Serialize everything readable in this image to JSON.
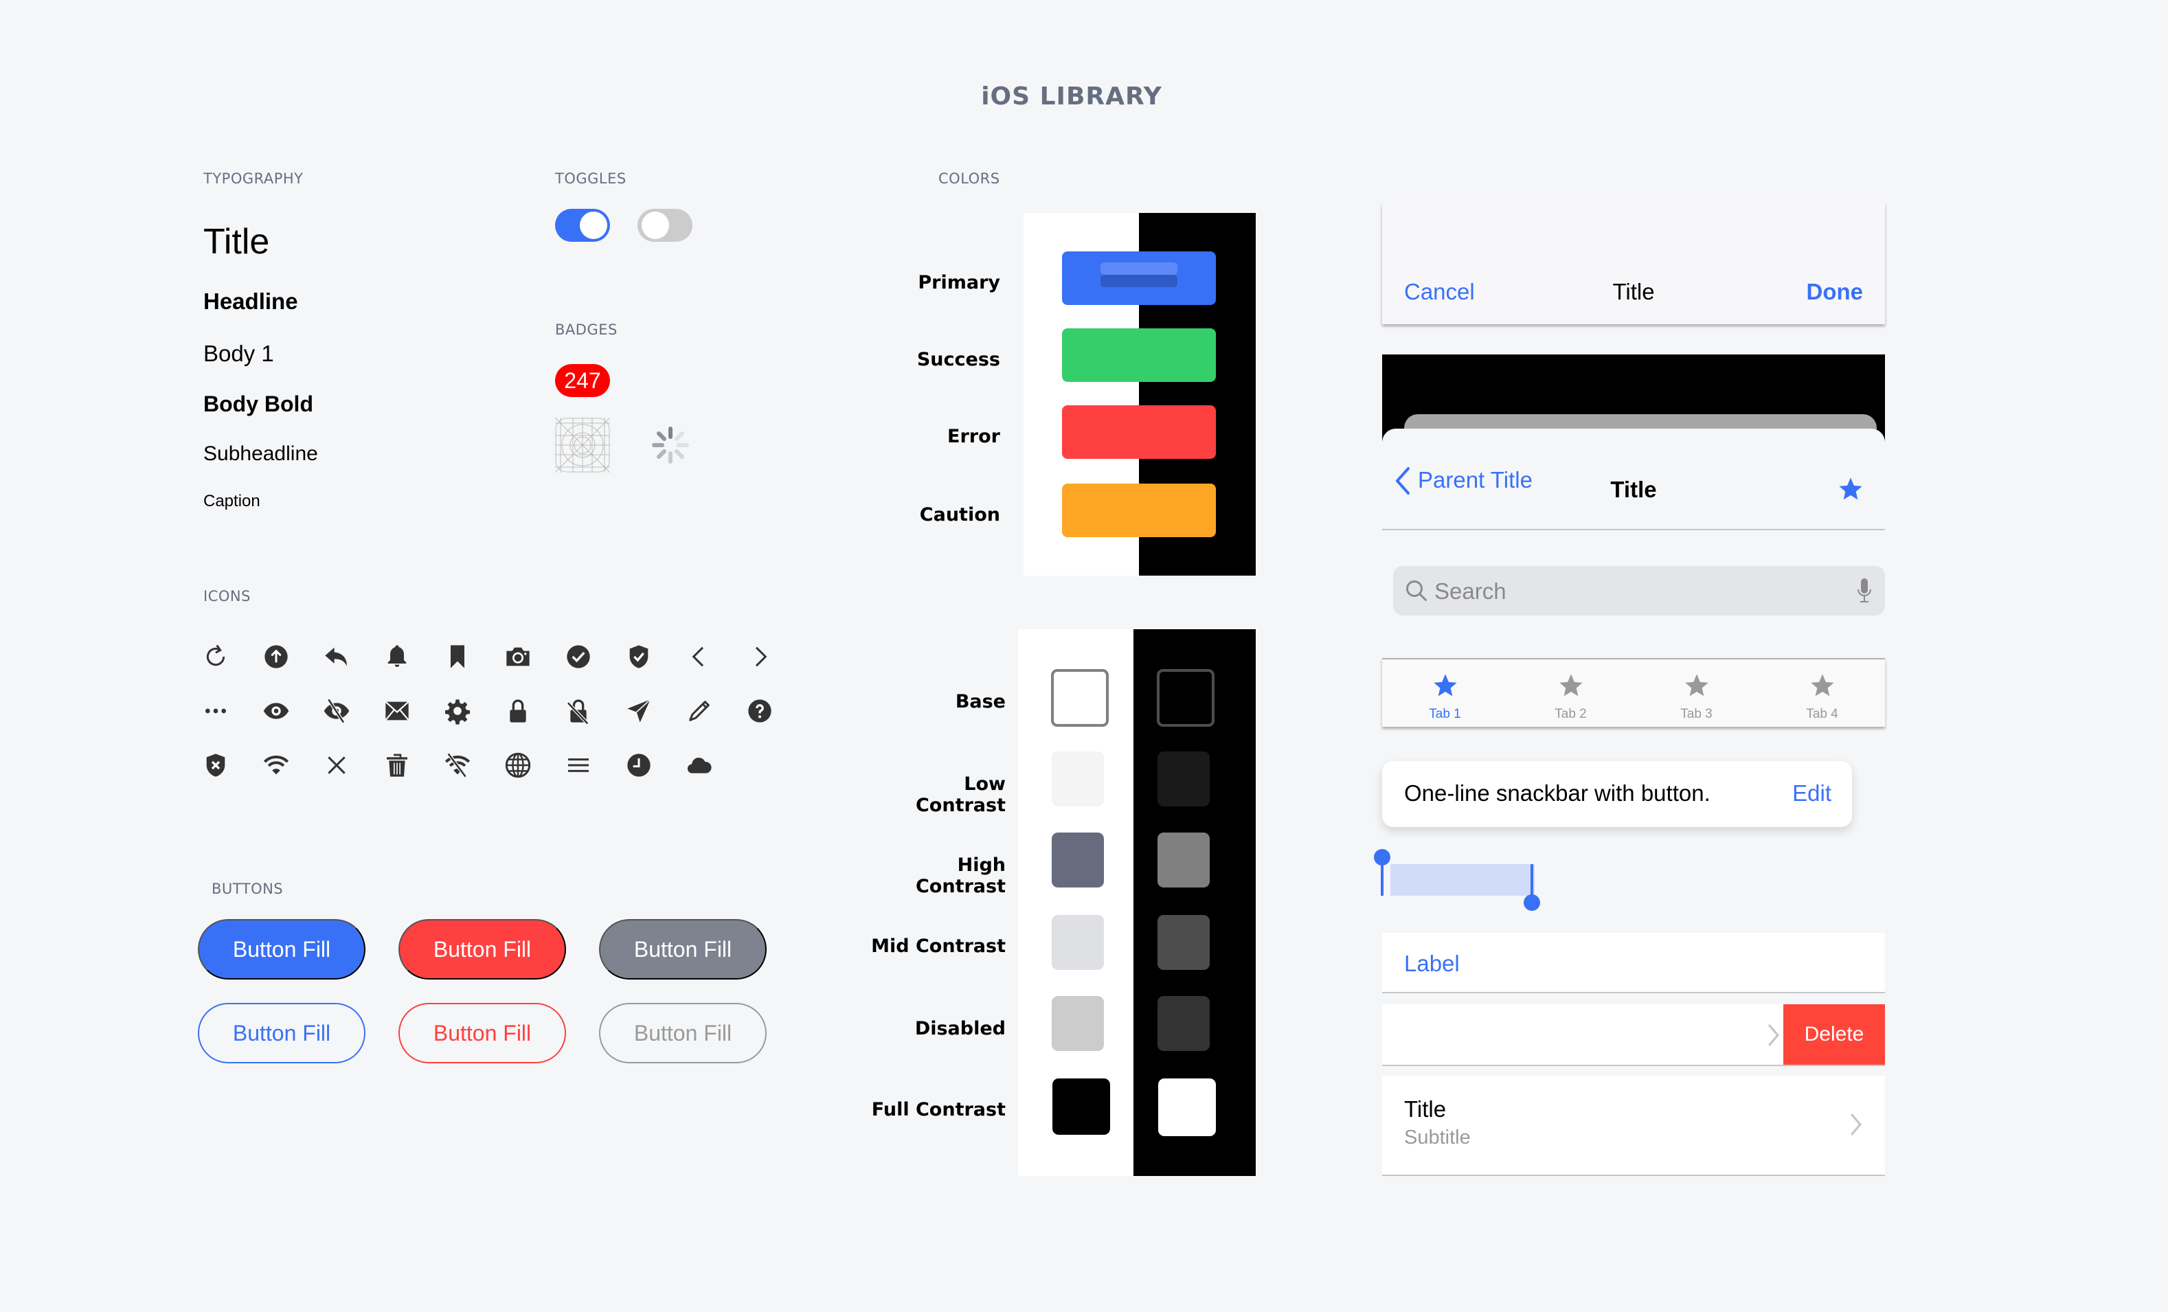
{
  "page": {
    "title": "iOS LIBRARY",
    "background": "#f5f6f8"
  },
  "sections": {
    "typography": "TYPOGRAPHY",
    "toggles": "TOGGLES",
    "badges": "BADGES",
    "icons": "ICONS",
    "buttons": "BUTTONS",
    "colors": "COLORS"
  },
  "typography": {
    "title": "Title",
    "headline": "Headline",
    "body1": "Body 1",
    "body_bold": "Body Bold",
    "subheadline": "Subheadline",
    "caption": "Caption"
  },
  "toggles": [
    {
      "state": "on",
      "color": "#3971f6"
    },
    {
      "state": "off",
      "color": "#cccccc"
    }
  ],
  "badges": {
    "count": "247",
    "count_color": "#ff0000",
    "app_icon_placeholder": "app-icon-grid",
    "spinner": "activity-indicator"
  },
  "icons": {
    "rows": [
      [
        "refresh-icon",
        "arrow-up-circle-icon",
        "reply-icon",
        "bell-icon",
        "bookmark-icon",
        "camera-icon",
        "checkmark-circle-icon",
        "shield-check-icon",
        "chevron-left-icon",
        "chevron-right-icon"
      ],
      [
        "more-horizontal-icon",
        "eye-icon",
        "eye-slash-icon",
        "envelope-icon",
        "gear-icon",
        "lock-icon",
        "lock-slash-icon",
        "send-icon",
        "pencil-icon",
        "question-circle-icon"
      ],
      [
        "shield-x-icon",
        "wifi-icon",
        "close-icon",
        "trash-icon",
        "wifi-slash-icon",
        "globe-icon",
        "menu-icon",
        "clock-icon",
        "cloud-icon"
      ]
    ],
    "color": "#333333"
  },
  "buttons": {
    "filled": [
      {
        "label": "Button Fill",
        "variant": "primary",
        "color": "#3971f6"
      },
      {
        "label": "Button Fill",
        "variant": "error",
        "color": "#ff4040"
      },
      {
        "label": "Button Fill",
        "variant": "neutral",
        "color": "#7e838f"
      }
    ],
    "outline": [
      {
        "label": "Button Fill",
        "variant": "primary",
        "color": "#3971f6"
      },
      {
        "label": "Button Fill",
        "variant": "error",
        "color": "#ff4040"
      },
      {
        "label": "Button Fill",
        "variant": "disabled",
        "color": "#9a9a9a"
      }
    ]
  },
  "colors": {
    "status": [
      {
        "label": "Primary",
        "color": "#3971f6"
      },
      {
        "label": "Success",
        "color": "#34cf6b"
      },
      {
        "label": "Error",
        "color": "#ff4040"
      },
      {
        "label": "Caution",
        "color": "#fda626"
      }
    ],
    "primary_states": {
      "hover": "#6089f8",
      "pressed": "#2d5ac4"
    },
    "neutrals": [
      {
        "label": "Base",
        "light": "#ffffff",
        "dark": "#000000",
        "light_border": "#808080",
        "dark_border": "#4d4d4d"
      },
      {
        "label": "Low Contrast",
        "light": "#f4f4f5",
        "dark": "#1a1a1a"
      },
      {
        "label": "High Contrast",
        "light": "#666b7d",
        "dark": "#808080"
      },
      {
        "label": "Mid Contrast",
        "light": "#dfe0e4",
        "dark": "#4d4d4d"
      },
      {
        "label": "Disabled",
        "light": "#cccccc",
        "dark": "#333333"
      },
      {
        "label": "Full Contrast",
        "light": "#000000",
        "dark": "#ffffff"
      }
    ]
  },
  "components": {
    "nav_bar": {
      "left": "Cancel",
      "title": "Title",
      "right": "Done"
    },
    "sheet_nav": {
      "back": "Parent Title",
      "title": "Title",
      "action_icon": "star-icon"
    },
    "search": {
      "placeholder": "Search",
      "value": ""
    },
    "tab_bar": {
      "tabs": [
        {
          "label": "Tab 1",
          "active": true
        },
        {
          "label": "Tab 2",
          "active": false
        },
        {
          "label": "Tab 3",
          "active": false
        },
        {
          "label": "Tab 4",
          "active": false
        }
      ],
      "active_color": "#3971f6",
      "inactive_color": "#999999"
    },
    "snackbar": {
      "message": "One-line snackbar with button.",
      "action": "Edit"
    },
    "text_selection": {
      "highlight": "#d0dcf8"
    },
    "list": {
      "label_row": "Label",
      "swipe_row": {
        "action": "Delete",
        "action_color": "#ff453a"
      },
      "detail_row": {
        "title": "Title",
        "subtitle": "Subtitle"
      }
    }
  }
}
